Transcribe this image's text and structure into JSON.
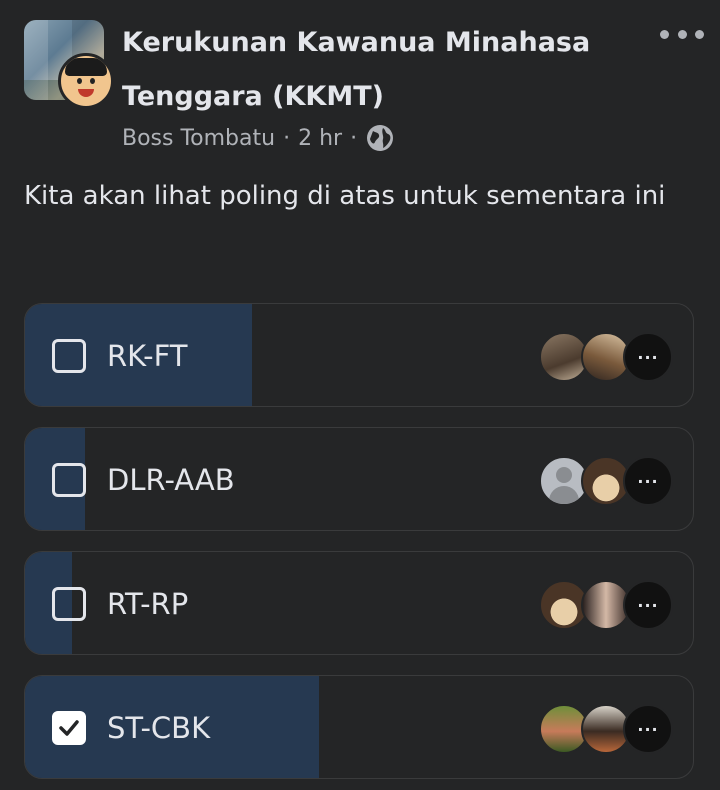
{
  "header": {
    "group_name": "Kerukunan Kawanua Minahasa Tenggara (KKMT)",
    "author": "Boss Tombatu",
    "time": "2 hr",
    "separator": "·"
  },
  "post": {
    "text": "Kita akan lihat poling di atas untuk sementara ini"
  },
  "poll": {
    "options": [
      {
        "label": "RK-FT",
        "checked": false,
        "fill_fraction": 0.34
      },
      {
        "label": "DLR-AAB",
        "checked": false,
        "fill_fraction": 0.09
      },
      {
        "label": "RT-RP",
        "checked": false,
        "fill_fraction": 0.07
      },
      {
        "label": "ST-CBK",
        "checked": true,
        "fill_fraction": 0.44
      }
    ],
    "more_voters_glyph": "···"
  },
  "colors": {
    "background": "#242526",
    "poll_fill": "#263951",
    "text_primary": "#e4e6eb",
    "text_secondary": "#b0b3b8"
  }
}
